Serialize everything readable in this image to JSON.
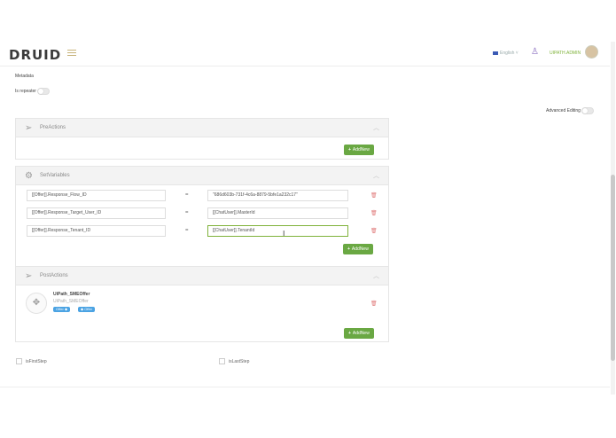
{
  "header": {
    "logo_text": "DRUID",
    "language": "English",
    "username": "UIPATH.ADMIN"
  },
  "metadata": {
    "label": "Metadata",
    "is_repeater_label": "Is repeater",
    "advanced_editing_label": "Advanced Editing"
  },
  "pre_actions": {
    "title": "PreActions",
    "add_label": "AddNew"
  },
  "set_variables": {
    "title": "SetVariables",
    "add_label": "AddNew",
    "rows": [
      {
        "left": "[[Offer]].Response_Flow_ID",
        "eq": "=",
        "right": "\"686d603b-731f-4c6a-8879-5bfe1a232c17\""
      },
      {
        "left": "[[Offer]].Response_Target_User_ID",
        "eq": "=",
        "right": "[[ChatUser]].MasterId"
      },
      {
        "left": "[[Offer]].Response_Tenant_ID",
        "eq": "=",
        "right": "[[ChatUser]].TenantId"
      }
    ]
  },
  "post_actions": {
    "title": "PostActions",
    "add_label": "AddNew",
    "item": {
      "name": "UiPath_SMEOffer",
      "subtitle": "UiPath_SMEOffer",
      "tags": [
        "Offer",
        "Offer"
      ]
    }
  },
  "footer": {
    "is_first_step_label": "isFirstStep",
    "is_last_step_label": "isLastStep"
  },
  "colors": {
    "accent_green": "#6aa843",
    "tag_blue": "#4ba3e3",
    "trash_red": "#e07a7a"
  }
}
